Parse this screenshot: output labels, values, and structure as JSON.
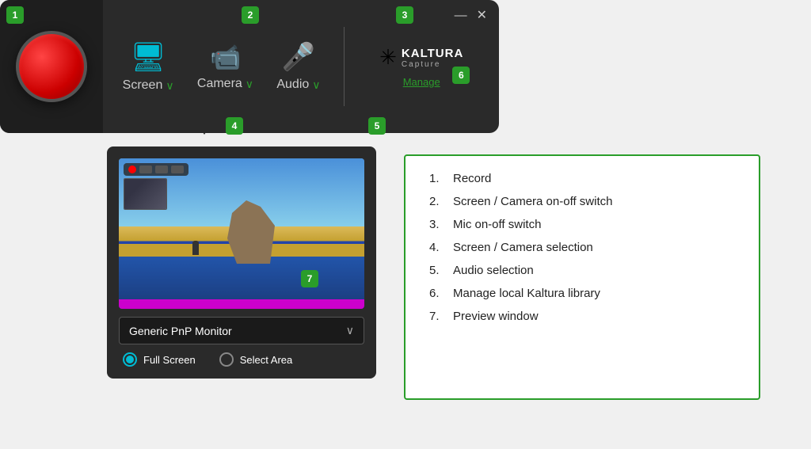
{
  "badges": {
    "b1": "1",
    "b2": "2",
    "b3": "3",
    "b4": "4",
    "b5": "5",
    "b6": "6",
    "b7": "7"
  },
  "toolbar": {
    "screen_label": "Screen",
    "camera_label": "Camera",
    "audio_label": "Audio",
    "kaltura_title": "KALTURA",
    "kaltura_sub": "Capture",
    "manage_label": "Manage",
    "minimize": "—",
    "close": "✕"
  },
  "dropdown": {
    "monitor_label": "Generic PnP Monitor",
    "full_screen": "Full Screen",
    "select_area": "Select Area"
  },
  "info": {
    "item1": "Record",
    "item2": "Screen / Camera on-off switch",
    "item3": "Mic on-off switch",
    "item4": "Screen / Camera selection",
    "item5": "Audio selection",
    "item6": "Manage local Kaltura library",
    "item7": "Preview window",
    "num1": "1.",
    "num2": "2.",
    "num3": "3.",
    "num4": "4.",
    "num5": "5.",
    "num6": "6.",
    "num7": "7."
  }
}
